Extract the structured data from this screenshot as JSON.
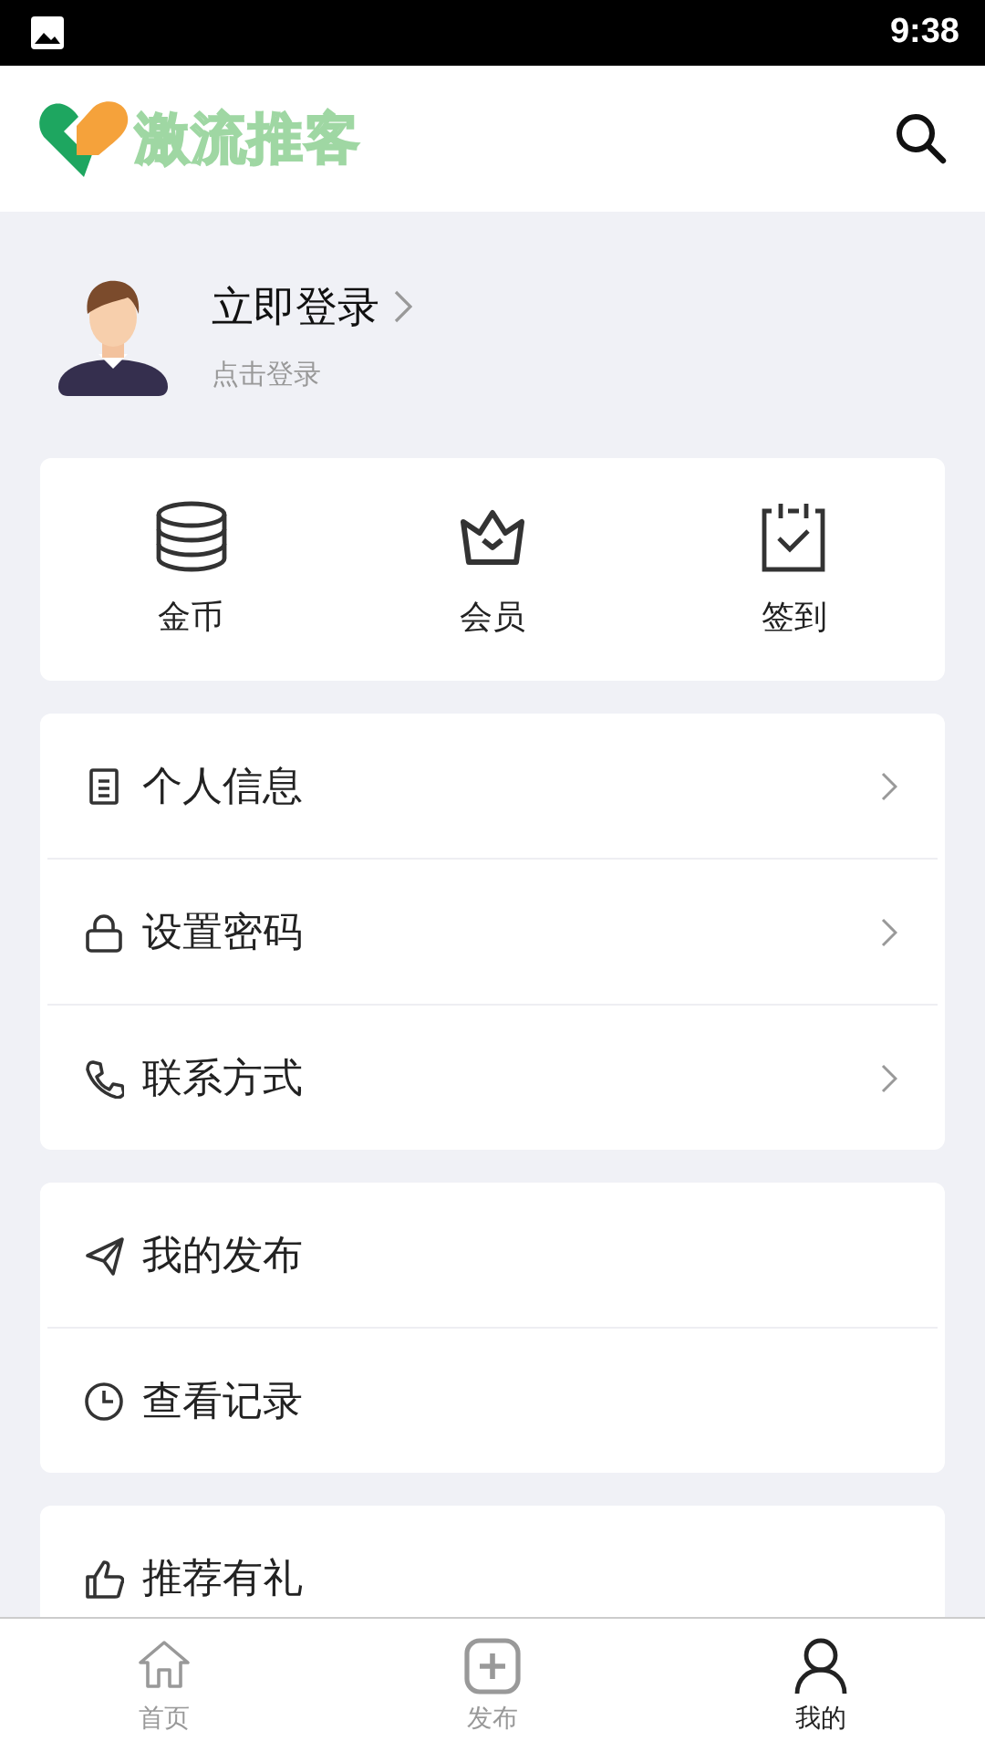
{
  "status_bar": {
    "time": "9:38"
  },
  "header": {
    "logo_text": "激流推客"
  },
  "profile": {
    "title": "立即登录",
    "subtitle": "点击登录"
  },
  "quick_actions": [
    {
      "label": "金币"
    },
    {
      "label": "会员"
    },
    {
      "label": "签到"
    }
  ],
  "menu_groups": [
    {
      "items": [
        {
          "label": "个人信息",
          "chevron": true
        },
        {
          "label": "设置密码",
          "chevron": true
        },
        {
          "label": "联系方式",
          "chevron": true
        }
      ]
    },
    {
      "items": [
        {
          "label": "我的发布",
          "chevron": false
        },
        {
          "label": "查看记录",
          "chevron": false
        }
      ]
    },
    {
      "items": [
        {
          "label": "推荐有礼",
          "chevron": false
        }
      ]
    }
  ],
  "bottom_nav": [
    {
      "label": "首页",
      "selected": false
    },
    {
      "label": "发布",
      "selected": false
    },
    {
      "label": "我的",
      "selected": true
    }
  ]
}
